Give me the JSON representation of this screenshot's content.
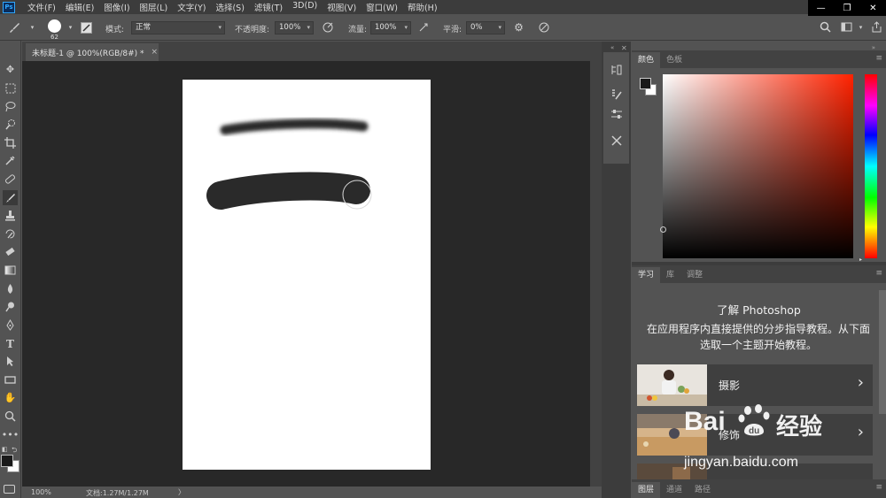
{
  "app": {
    "logo": "Ps"
  },
  "menu": [
    "文件(F)",
    "编辑(E)",
    "图像(I)",
    "图层(L)",
    "文字(Y)",
    "选择(S)",
    "滤镜(T)",
    "3D(D)",
    "视图(V)",
    "窗口(W)",
    "帮助(H)"
  ],
  "window_controls": {
    "minimize": "—",
    "restore": "❐",
    "close": "✕"
  },
  "options": {
    "brush_size": "62",
    "mode_label": "模式:",
    "mode_value": "正常",
    "opacity_label": "不透明度:",
    "opacity_value": "100%",
    "flow_label": "流量:",
    "flow_value": "100%",
    "smoothing_label": "平滑:",
    "smoothing_value": "0%"
  },
  "document": {
    "tab_title": "未标题-1 @ 100%(RGB/8#) *",
    "close": "×"
  },
  "status": {
    "zoom": "100%",
    "doc_info": "文档:1.27M/1.27M",
    "arrow": "〉"
  },
  "color_panel": {
    "tabs": [
      "颜色",
      "色板"
    ],
    "foreground": "#1a1a1a",
    "background": "#ffffff",
    "hue_color": "#ff2200"
  },
  "learn_panel": {
    "tabs": [
      "学习",
      "库",
      "调整"
    ],
    "title": "了解 Photoshop",
    "description": "在应用程序内直接提供的分步指导教程。从下面选取一个主题开始教程。",
    "cards": [
      {
        "title": "摄影"
      },
      {
        "title": "修饰"
      }
    ]
  },
  "layers_panel": {
    "tabs": [
      "图层",
      "通道",
      "路径"
    ]
  },
  "watermark": {
    "brand_b": "Bai",
    "brand_c": "du",
    "brand_cn": "经验",
    "url": "jingyan.baidu.com"
  }
}
